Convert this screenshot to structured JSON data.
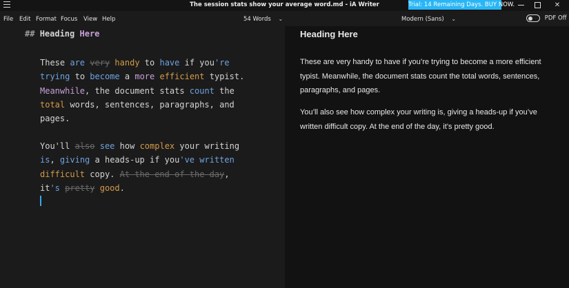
{
  "window": {
    "title": "The session stats show your average word.md - iA Writer",
    "trial_banner": "Trial: 14 Remaining Days. BUY NOW.",
    "buttons": {
      "minimize": "",
      "maximize": "",
      "close": "✕"
    }
  },
  "menu": {
    "items": [
      "File",
      "Edit",
      "Format",
      "Focus",
      "View",
      "Help"
    ],
    "stats": "54 Words",
    "font": "Modern (Sans)",
    "pdf_off": "PDF Off"
  },
  "editor": {
    "heading_marker": "##",
    "heading_words": [
      "Heading",
      "Here"
    ],
    "p1": {
      "w1": "These",
      "w2": "are",
      "w3": "very",
      "w4": "handy",
      "w5": "to",
      "w6": "have",
      "w7": "if",
      "w8": "you",
      "w9": "'re",
      "w10": "trying",
      "w11": "to",
      "w12": "become",
      "w13": "a",
      "w14": "more",
      "w15": "efficient",
      "w16": "typist.",
      "w17": "Meanwhile",
      "w18": ", the",
      "w19": "document",
      "w20": "stats",
      "w21": "count",
      "w22": "the",
      "w23": "total",
      "w24": "words, sentences, paragraphs, and",
      "w25": "pages."
    },
    "p2": {
      "w1": "You'll",
      "w2": "also",
      "w3": "see",
      "w4": "how",
      "w5": "complex",
      "w6": "your",
      "w7": "writing",
      "w8": "is",
      "w9": ",",
      "w10": "giving",
      "w11": "a heads-up if you",
      "w12": "'ve",
      "w13": "written",
      "w14": "difficult",
      "w15": "copy.",
      "w16": "At the end of the day",
      "w17": ",",
      "w18": "it",
      "w19": "'s",
      "w20": "pretty",
      "w21": "good",
      "w22": "."
    }
  },
  "preview": {
    "heading": "Heading Here",
    "p1": "These are very handy to have if you’re trying to become a more efficient typist. Meanwhile, the document stats count the total words, sentences, paragraphs, and pages.",
    "p2": "You’ll also see how complex your writing is, giving a heads-up if you’ve written difficult copy. At the end of the day, it’s pretty good."
  },
  "colors": {
    "noun": "#c7a0d8",
    "verb": "#6fa2de",
    "adjective": "#d49a4a",
    "filler": "#6a6a6a",
    "trial_banner": "#29b6f6",
    "cursor": "#3aa8e8"
  },
  "icons": {
    "menu": "hamburger-icon",
    "chevron": "chevron-down-icon",
    "toggle": "toggle-off-icon"
  }
}
